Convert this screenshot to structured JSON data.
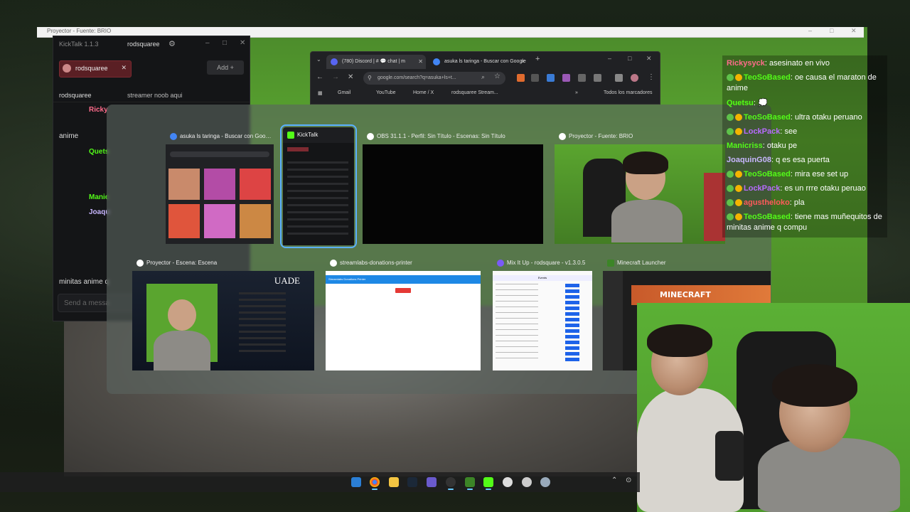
{
  "projector": {
    "title": "Proyector - Fuente: BRIO"
  },
  "kicktalk": {
    "app_title": "KickTalk 1.1.3",
    "current_user": "rodsquaree",
    "chip_label": "rodsquaree",
    "add_label": "Add",
    "channel": "rodsquaree",
    "stream_title": "streamer noob aqui",
    "send_placeholder": "Send a messa",
    "fragments": [
      "Ricky",
      "anime",
      "Quets",
      "Manic",
      "Joaqu",
      "minitas anime q"
    ]
  },
  "chrome": {
    "tabs": [
      "(780) Discord | # 💬 chat | m",
      "asuka ls taringa - Buscar con Google"
    ],
    "url": "google.com/search?q=asuka+ls+t...",
    "bookmarks": [
      "Gmail",
      "YouTube",
      "Home / X",
      "rodsquaree Stream...",
      "Todos los marcadores"
    ]
  },
  "switcher": {
    "row1": [
      {
        "title": "asuka ls taringa - Buscar con Googl...",
        "icon_color": "#4285f4"
      },
      {
        "title": "KickTalk",
        "icon_color": "#53fc18"
      },
      {
        "title": "OBS 31.1.1 - Perfil: Sin Título - Escenas: Sin Título",
        "icon_color": "#ffffff"
      },
      {
        "title": "Proyector - Fuente: BRIO",
        "icon_color": "#ffffff"
      }
    ],
    "row2": [
      {
        "title": "Proyector - Escena: Escena",
        "icon_color": "#ffffff"
      },
      {
        "title": "streamlabs-donations-printer",
        "icon_color": "#ffffff"
      },
      {
        "title": "Mix It Up - rodsquare - v1.3.0.5",
        "icon_color": "#7a5af8"
      },
      {
        "title": "Minecraft Launcher",
        "icon_color": "#3c8527"
      }
    ],
    "thumb_texts": {
      "uade": "UADE",
      "donations_bar": "Streamlabs Donations Printer",
      "minecraft": "MINECRAFT",
      "mix_header": "Events"
    }
  },
  "chat": [
    {
      "user": "Rickysyck",
      "color": "#ff6b8b",
      "badges": 0,
      "text": "asesinato en vivo"
    },
    {
      "user": "TeoSoBased",
      "color": "#53fc18",
      "badges": 2,
      "text": "oe causa el maraton de anime"
    },
    {
      "user": "Quetsu",
      "color": "#53fc18",
      "badges": 0,
      "text": "💭"
    },
    {
      "user": "TeoSoBased",
      "color": "#53fc18",
      "badges": 2,
      "text": "ultra otaku peruano"
    },
    {
      "user": "LockPack",
      "color": "#b86bff",
      "badges": 2,
      "text": "see"
    },
    {
      "user": "Manicriss",
      "color": "#53fc18",
      "badges": 0,
      "text": "otaku pe"
    },
    {
      "user": "JoaquinG08",
      "color": "#c8b6ff",
      "badges": 0,
      "text": "q es esa puerta"
    },
    {
      "user": "TeoSoBased",
      "color": "#53fc18",
      "badges": 2,
      "text": "mira ese set up"
    },
    {
      "user": "LockPack",
      "color": "#b86bff",
      "badges": 2,
      "text": "es un rrre otaku peruao"
    },
    {
      "user": "agustheloko",
      "color": "#ff5a5a",
      "badges": 2,
      "text": "pla"
    },
    {
      "user": "TeoSoBased",
      "color": "#53fc18",
      "badges": 2,
      "text": "tiene mas muñequitos de minitas anime q compu"
    }
  ],
  "taskbar": {
    "icons": [
      "windows-start",
      "chrome",
      "file-explorer",
      "steam",
      "arrow-app",
      "obs",
      "minecraft",
      "kick",
      "app-circle-1",
      "app-circle-2",
      "app-circle-3"
    ]
  }
}
